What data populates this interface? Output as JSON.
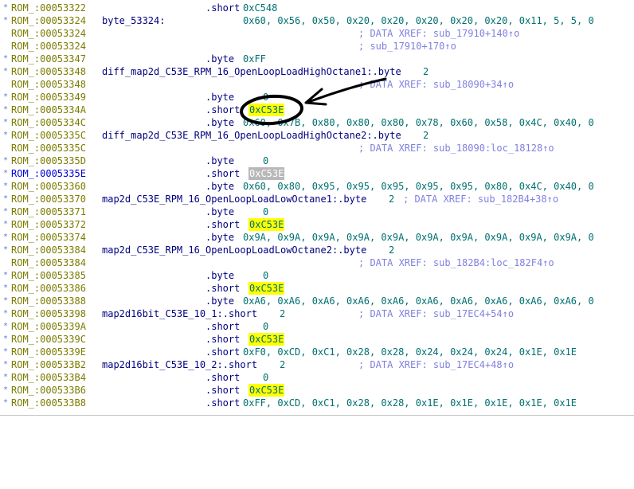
{
  "listing": {
    "lines": [
      {
        "marker": "*",
        "addr": "ROM_:00053322",
        "label": "",
        "instr": ".short",
        "operand": "0xC548",
        "xref": "",
        "highlight": ""
      },
      {
        "marker": "*",
        "addr": "ROM_:00053324",
        "label": "byte_53324:",
        "instr": ".byte",
        "operand": "0x60, 0x56, 0x50, 0x20, 0x20, 0x20, 0x20, 0x20, 0x11, 5, 5, 0",
        "xref": "",
        "highlight": ""
      },
      {
        "marker": "",
        "addr": "ROM_:00053324",
        "label": "",
        "instr": "",
        "operand": "",
        "xref": "; DATA XREF: sub_17910+140↑o",
        "highlight": ""
      },
      {
        "marker": "",
        "addr": "ROM_:00053324",
        "label": "",
        "instr": "",
        "operand": "",
        "xref": "; sub_17910+170↑o",
        "highlight": ""
      },
      {
        "marker": "*",
        "addr": "ROM_:00053347",
        "label": "",
        "instr": ".byte",
        "operand": "0xFF",
        "xref": "",
        "highlight": ""
      },
      {
        "marker": "*",
        "addr": "ROM_:00053348",
        "label": "diff_map2d_C53E_RPM_16_OpenLoopLoadHighOctane1:.byte",
        "instr": "",
        "operand": "2",
        "xref": "",
        "highlight": ""
      },
      {
        "marker": "",
        "addr": "ROM_:00053348",
        "label": "",
        "instr": "",
        "operand": "",
        "xref": "; DATA XREF: sub_18090+34↑o",
        "highlight": ""
      },
      {
        "marker": "*",
        "addr": "ROM_:00053349",
        "label": "",
        "instr": ".byte",
        "operand": "0",
        "xref": "",
        "highlight": ""
      },
      {
        "marker": "*",
        "addr": "ROM_:0005334A",
        "label": "",
        "instr": ".short",
        "operand": "0xC53E",
        "xref": "",
        "highlight": "yellow"
      },
      {
        "marker": "*",
        "addr": "ROM_:0005334C",
        "label": "",
        "instr": ".byte",
        "operand": "0x60, 0x7B, 0x80, 0x80, 0x80, 0x78, 0x60, 0x58, 0x4C, 0x40, 0",
        "xref": "",
        "highlight": ""
      },
      {
        "marker": "*",
        "addr": "ROM_:0005335C",
        "label": "diff_map2d_C53E_RPM_16_OpenLoopLoadHighOctane2:.byte",
        "instr": "",
        "operand": "2",
        "xref": "",
        "highlight": ""
      },
      {
        "marker": "",
        "addr": "ROM_:0005335C",
        "label": "",
        "instr": "",
        "operand": "",
        "xref": "; DATA XREF: sub_18090:loc_18128↑o",
        "highlight": ""
      },
      {
        "marker": "*",
        "addr": "ROM_:0005335D",
        "label": "",
        "instr": ".byte",
        "operand": "0",
        "xref": "",
        "highlight": ""
      },
      {
        "marker": "*",
        "addr": "ROM_:0005335E",
        "label": "",
        "instr": ".short",
        "operand": "0xC53E",
        "xref": "",
        "highlight": "grey",
        "selected": true
      },
      {
        "marker": "*",
        "addr": "ROM_:00053360",
        "label": "",
        "instr": ".byte",
        "operand": "0x60, 0x80, 0x95, 0x95, 0x95, 0x95, 0x95, 0x80, 0x4C, 0x40, 0",
        "xref": "",
        "highlight": ""
      },
      {
        "marker": "*",
        "addr": "ROM_:00053370",
        "label": "map2d_C53E_RPM_16_OpenLoopLoadLowOctane1:.byte",
        "instr": "",
        "operand": "2",
        "xref": "; DATA XREF: sub_182B4+38↑o",
        "highlight": "",
        "inline_xref": true
      },
      {
        "marker": "*",
        "addr": "ROM_:00053371",
        "label": "",
        "instr": ".byte",
        "operand": "0",
        "xref": "",
        "highlight": ""
      },
      {
        "marker": "*",
        "addr": "ROM_:00053372",
        "label": "",
        "instr": ".short",
        "operand": "0xC53E",
        "xref": "",
        "highlight": "yellow"
      },
      {
        "marker": "*",
        "addr": "ROM_:00053374",
        "label": "",
        "instr": ".byte",
        "operand": "0x9A, 0x9A, 0x9A, 0x9A, 0x9A, 0x9A, 0x9A, 0x9A, 0x9A, 0x9A, 0",
        "xref": "",
        "highlight": ""
      },
      {
        "marker": "*",
        "addr": "ROM_:00053384",
        "label": "map2d_C53E_RPM_16_OpenLoopLoadLowOctane2:.byte",
        "instr": "",
        "operand": "2",
        "xref": "",
        "highlight": ""
      },
      {
        "marker": "",
        "addr": "ROM_:00053384",
        "label": "",
        "instr": "",
        "operand": "",
        "xref": "; DATA XREF: sub_182B4:loc_182F4↑o",
        "highlight": ""
      },
      {
        "marker": "*",
        "addr": "ROM_:00053385",
        "label": "",
        "instr": ".byte",
        "operand": "0",
        "xref": "",
        "highlight": ""
      },
      {
        "marker": "*",
        "addr": "ROM_:00053386",
        "label": "",
        "instr": ".short",
        "operand": "0xC53E",
        "xref": "",
        "highlight": "yellow"
      },
      {
        "marker": "*",
        "addr": "ROM_:00053388",
        "label": "",
        "instr": ".byte",
        "operand": "0xA6, 0xA6, 0xA6, 0xA6, 0xA6, 0xA6, 0xA6, 0xA6, 0xA6, 0xA6, 0",
        "xref": "",
        "highlight": ""
      },
      {
        "marker": "*",
        "addr": "ROM_:00053398",
        "label": "map2d16bit_C53E_10_1:.short",
        "instr": "",
        "operand": "2",
        "xref": "; DATA XREF: sub_17EC4+54↑o",
        "highlight": ""
      },
      {
        "marker": "*",
        "addr": "ROM_:0005339A",
        "label": "",
        "instr": ".short",
        "operand": "0",
        "xref": "",
        "highlight": ""
      },
      {
        "marker": "*",
        "addr": "ROM_:0005339C",
        "label": "",
        "instr": ".short",
        "operand": "0xC53E",
        "xref": "",
        "highlight": "yellow"
      },
      {
        "marker": "*",
        "addr": "ROM_:0005339E",
        "label": "",
        "instr": ".short",
        "operand": "0xF0, 0xCD, 0xC1, 0x28, 0x28, 0x24, 0x24, 0x24, 0x1E, 0x1E",
        "xref": "",
        "highlight": ""
      },
      {
        "marker": "*",
        "addr": "ROM_:000533B2",
        "label": "map2d16bit_C53E_10_2:.short",
        "instr": "",
        "operand": "2",
        "xref": "; DATA XREF: sub_17EC4+48↑o",
        "highlight": ""
      },
      {
        "marker": "*",
        "addr": "ROM_:000533B4",
        "label": "",
        "instr": ".short",
        "operand": "0",
        "xref": "",
        "highlight": ""
      },
      {
        "marker": "*",
        "addr": "ROM_:000533B6",
        "label": "",
        "instr": ".short",
        "operand": "0xC53E",
        "xref": "",
        "highlight": "yellow"
      },
      {
        "marker": "*",
        "addr": "ROM_:000533B8",
        "label": "",
        "instr": ".short",
        "operand": "0xFF, 0xCD, 0xC1, 0x28, 0x28, 0x1E, 0x1E, 0x1E, 0x1E, 0x1E",
        "xref": "",
        "highlight": ""
      }
    ]
  },
  "colors": {
    "address": "#7b7b00",
    "address_selected": "#0000d8",
    "mnemonic": "#000080",
    "operand": "#007070",
    "xref": "#8080e0",
    "highlight": "#ffff00",
    "highlight_selected": "#b8b8b8"
  }
}
